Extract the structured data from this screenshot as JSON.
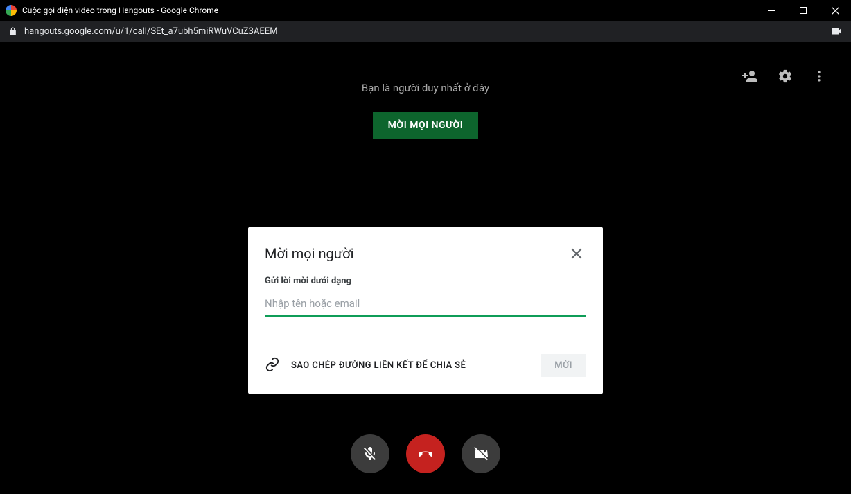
{
  "window": {
    "title": "Cuộc gọi điện video trong Hangouts - Google Chrome"
  },
  "address": {
    "url": "hangouts.google.com/u/1/call/SEt_a7ubh5miRWuVCuZ3AEEM"
  },
  "banner": {
    "text": "Bạn là người duy nhất ở đây",
    "button": "MỜI MỌI NGƯỜI"
  },
  "modal": {
    "title": "Mời mọi người",
    "subhead": "Gửi lời mời dưới dạng",
    "placeholder": "Nhập tên hoặc email",
    "copy_link_label": "SAO CHÉP ĐƯỜNG LIÊN KẾT ĐỂ CHIA SẺ",
    "send_label": "MỜI"
  },
  "icons": {
    "add_user": "person-add-icon",
    "settings": "gear-icon",
    "more": "more-vert-icon",
    "mute_mic": "microphone-off-icon",
    "hangup": "phone-hangup-icon",
    "cam_off": "video-off-icon"
  }
}
